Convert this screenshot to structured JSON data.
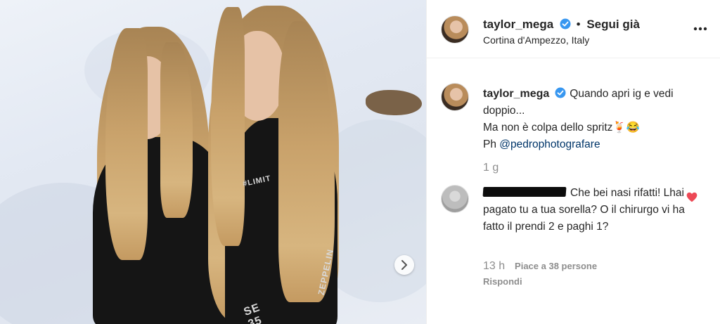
{
  "post": {
    "username": "taylor_mega",
    "separator": "•",
    "follow_label": "Segui già",
    "location": "Cortina d'Ampezzo, Italy"
  },
  "caption": {
    "username": "taylor_mega",
    "line1": "Quando apri ig e vedi doppio...",
    "line2": "Ma non è colpa dello spritz🍹😂",
    "prefix": "Ph",
    "mention": "@pedrophotografare",
    "time": "1 g"
  },
  "comment": {
    "text": "Che bei nasi rifatti! Lhai pagato tu a tua sorella? O il chirurgo vi ha fatto il prendi 2 e paghi 1?",
    "time": "13 h",
    "likes_label": "Piace a 38 persone",
    "reply_label": "Rispondi"
  },
  "photo": {
    "suit_text_left": "#LIMIT",
    "suit_text_sleeve": "SE 35",
    "suit_text_arm": "ZEPPELIN"
  },
  "colors": {
    "verified": "#3897f0",
    "heart": "#ed4956",
    "mention": "#003569",
    "muted": "#8e8e8e"
  },
  "icons": {
    "verified": "verified-badge-icon",
    "more": "more-options-icon",
    "heart": "heart-icon",
    "next": "chevron-right-icon"
  }
}
